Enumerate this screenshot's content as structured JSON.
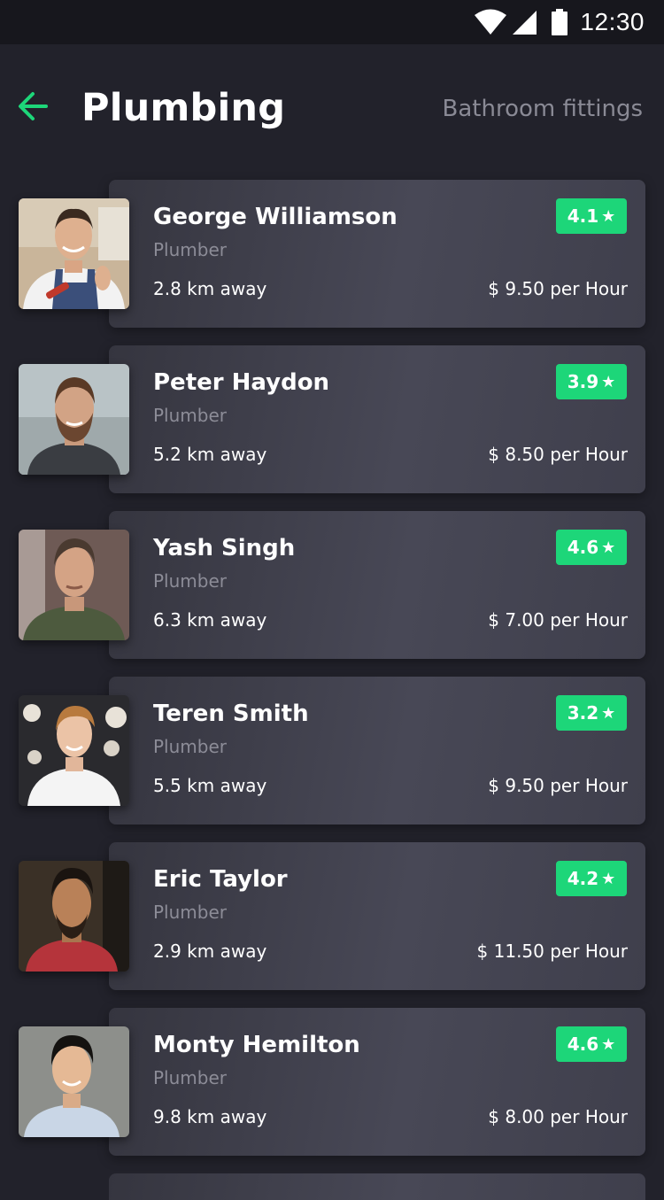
{
  "status_bar": {
    "time": "12:30",
    "icons": [
      "wifi-icon",
      "signal-icon",
      "battery-icon"
    ]
  },
  "header": {
    "back_icon": "arrow-left-icon",
    "title": "Plumbing",
    "tab_label": "Bathroom fittings"
  },
  "colors": {
    "accent": "#1dd679",
    "background": "#22222b",
    "card": "#42424f",
    "muted_text": "#8c8c97"
  },
  "providers": [
    {
      "name": "George Williamson",
      "role": "Plumber",
      "distance": "2.8 km away",
      "price": "$ 9.50 per Hour",
      "rating": "4.1",
      "star": "★"
    },
    {
      "name": "Peter Haydon",
      "role": "Plumber",
      "distance": "5.2 km away",
      "price": "$ 8.50 per Hour",
      "rating": "3.9",
      "star": "★"
    },
    {
      "name": "Yash Singh",
      "role": "Plumber",
      "distance": "6.3 km away",
      "price": "$ 7.00 per Hour",
      "rating": "4.6",
      "star": "★"
    },
    {
      "name": "Teren Smith",
      "role": "Plumber",
      "distance": "5.5 km away",
      "price": "$ 9.50 per Hour",
      "rating": "3.2",
      "star": "★"
    },
    {
      "name": "Eric Taylor",
      "role": "Plumber",
      "distance": "2.9 km away",
      "price": "$ 11.50 per Hour",
      "rating": "4.2",
      "star": "★"
    },
    {
      "name": "Monty Hemilton",
      "role": "Plumber",
      "distance": "9.8 km away",
      "price": "$ 8.00 per Hour",
      "rating": "4.6",
      "star": "★"
    }
  ]
}
